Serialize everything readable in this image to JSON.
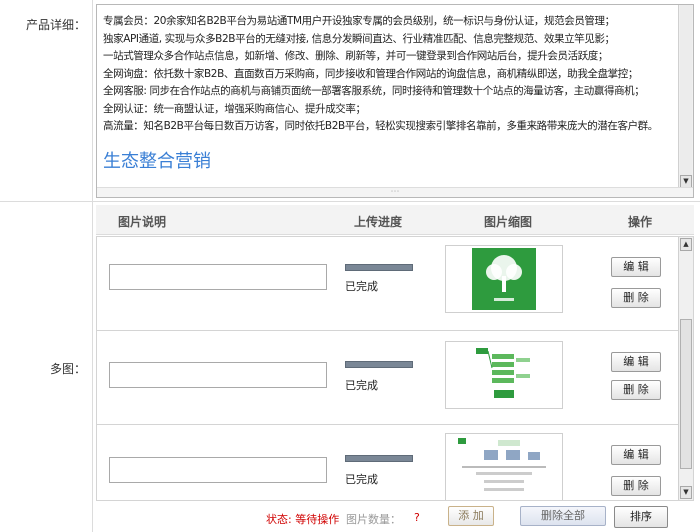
{
  "product_detail": {
    "label": "产品详细：",
    "lines": [
      " 专属会员：20余家知名B2B平台为易站通TM用户开设独家专属的会员级别，统一标识与身份认证，规范会员管理；",
      "独家API通道, 实现与众多B2B平台的无缝对接, 信息分发瞬间直达、行业精准匹配、信息完整规范、效果立竿见影；",
      "一站式管理众多合作站点信息，如新增、修改、删除、刷新等，并可一键登录到合作网站后台，提升会员活跃度；",
      "全网询盘：依托数十家B2B、直面数百万采购商，同步接收和管理合作网站的询盘信息，商机精纵即送，助我全盘掌控；",
      "全网客服: 同步在合作站点的商机与商铺页面统一部署客服系统，同时接待和管理数十个站点的海量访客，主动赢得商机；",
      "全网认证：统一商盟认证，增强采购商信心、提升成交率；"
    ],
    "wrap_line": "高流量：知名B2B平台每日数百万访客，同时依托B2B平台，轻松实现搜索引擎排名靠前，多重来路带来庞大的潜在客户群。",
    "heading": "生态整合营销"
  },
  "multi_image": {
    "label": "多图：",
    "columns": [
      "图片说明",
      "上传进度",
      "图片缩图",
      "操作"
    ],
    "rows": [
      {
        "progress_text": "已完成",
        "progress": 1.0,
        "edit": "编 辑",
        "delete": "删 除"
      },
      {
        "progress_text": "已完成",
        "progress": 1.0,
        "edit": "编 辑",
        "delete": "删 除"
      },
      {
        "progress_text": "已完成",
        "progress": 1.0,
        "edit": "编 辑",
        "delete": "删 除"
      }
    ]
  },
  "footer": {
    "status": "状态: 等待操作",
    "count_label": "图片数量：",
    "count_value": "?",
    "add": "添 加",
    "delete_all": "删除全部",
    "sort": "排序"
  }
}
